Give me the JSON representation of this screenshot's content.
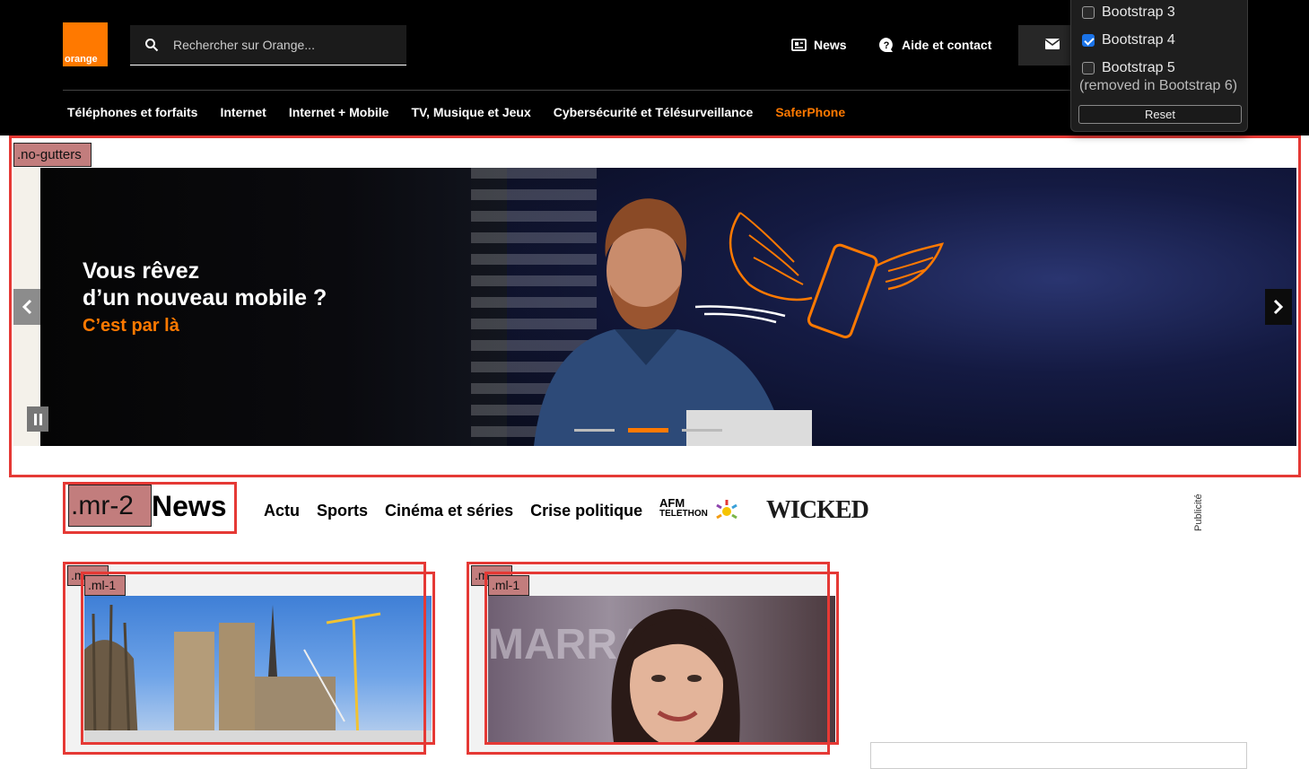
{
  "header": {
    "logo_text": "orange",
    "search_placeholder": "Rechercher sur Orange...",
    "links": {
      "news": "News",
      "help": "Aide et contact"
    },
    "nav": [
      "Téléphones et forfaits",
      "Internet",
      "Internet + Mobile",
      "TV, Musique et Jeux",
      "Cybersécurité et Télésurveillance",
      "SaferPhone"
    ]
  },
  "bootstrap_panel": {
    "options": [
      {
        "label": "Bootstrap 3",
        "checked": false
      },
      {
        "label": "Bootstrap 4",
        "checked": true
      },
      {
        "label": "Bootstrap 5",
        "checked": false
      }
    ],
    "note": "(removed in Bootstrap 6)",
    "reset_label": "Reset"
  },
  "debug_labels": {
    "no_gutters": ".no-gutters",
    "mr2": ".mr-2",
    "ml1": ".ml-1",
    "ml1_hidden": ".m"
  },
  "hero": {
    "title_line1": "Vous rêvez",
    "title_line2": "d’un nouveau mobile ?",
    "cta": "C’est par là"
  },
  "news": {
    "title": "News",
    "nav": [
      "Actu",
      "Sports",
      "Cinéma et séries",
      "Crise politique"
    ],
    "sponsor_afm_line1": "AFM",
    "sponsor_afm_line2": "TELETHON",
    "sponsor_wicked": "WICKED",
    "ad_label": "Publicité"
  },
  "colors": {
    "brand": "#ff7900",
    "debug": "#e53935",
    "header_bg": "#000000"
  }
}
